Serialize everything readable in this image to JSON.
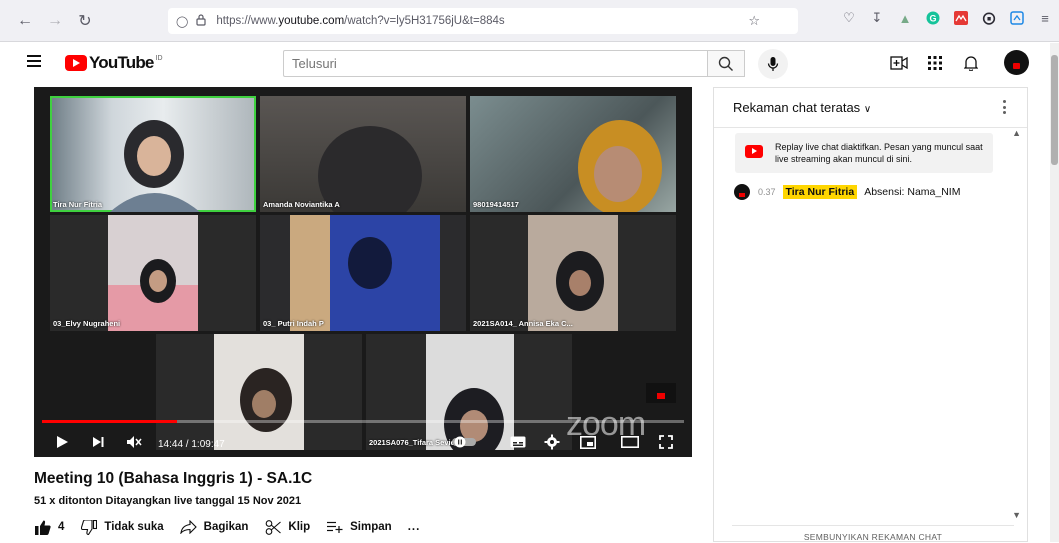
{
  "browser": {
    "url_prefix": "https://www.",
    "url_domain": "youtube.com",
    "url_rest": "/watch?v=ly5H31756jU&t=884s"
  },
  "youtube": {
    "logo_text": "YouTube",
    "logo_sup": "ID",
    "search_placeholder": "Telusuri"
  },
  "player": {
    "participants": [
      {
        "name": "Tira Nur Fitria",
        "active": true
      },
      {
        "name": "Amanda Noviantika A",
        "active": false
      },
      {
        "name": "98019414517",
        "active": false
      },
      {
        "name": "03_Elvy Nugraheni",
        "active": false
      },
      {
        "name": "03_ Putri Indah P",
        "active": false
      },
      {
        "name": "2021SA014_ Annisa Eka C...",
        "active": false
      },
      {
        "name": "2021SA076_Tifara Sevid",
        "active": false
      }
    ],
    "zoom_watermark": "zoom",
    "time_display": "14:44 / 1:09:47",
    "progress_fraction": 0.211,
    "accent_color": "#ff0000"
  },
  "video": {
    "title": "Meeting 10 (Bahasa Inggris 1) - SA.1C",
    "meta": "51 x ditonton  Ditayangkan live tanggal 15 Nov 2021",
    "likes": "4",
    "dislike_label": "Tidak suka",
    "share_label": "Bagikan",
    "clip_label": "Klip",
    "save_label": "Simpan",
    "more_label": "..."
  },
  "chat": {
    "header": "Rekaman chat teratas",
    "notice": "Replay live chat diaktifkan. Pesan yang muncul saat live streaming akan muncul di sini.",
    "messages": [
      {
        "timestamp": "0.37",
        "author": "Tira Nur Fitria",
        "text": "Absensi: Nama_NIM"
      }
    ],
    "footer": "SEMBUNYIKAN REKAMAN CHAT"
  }
}
